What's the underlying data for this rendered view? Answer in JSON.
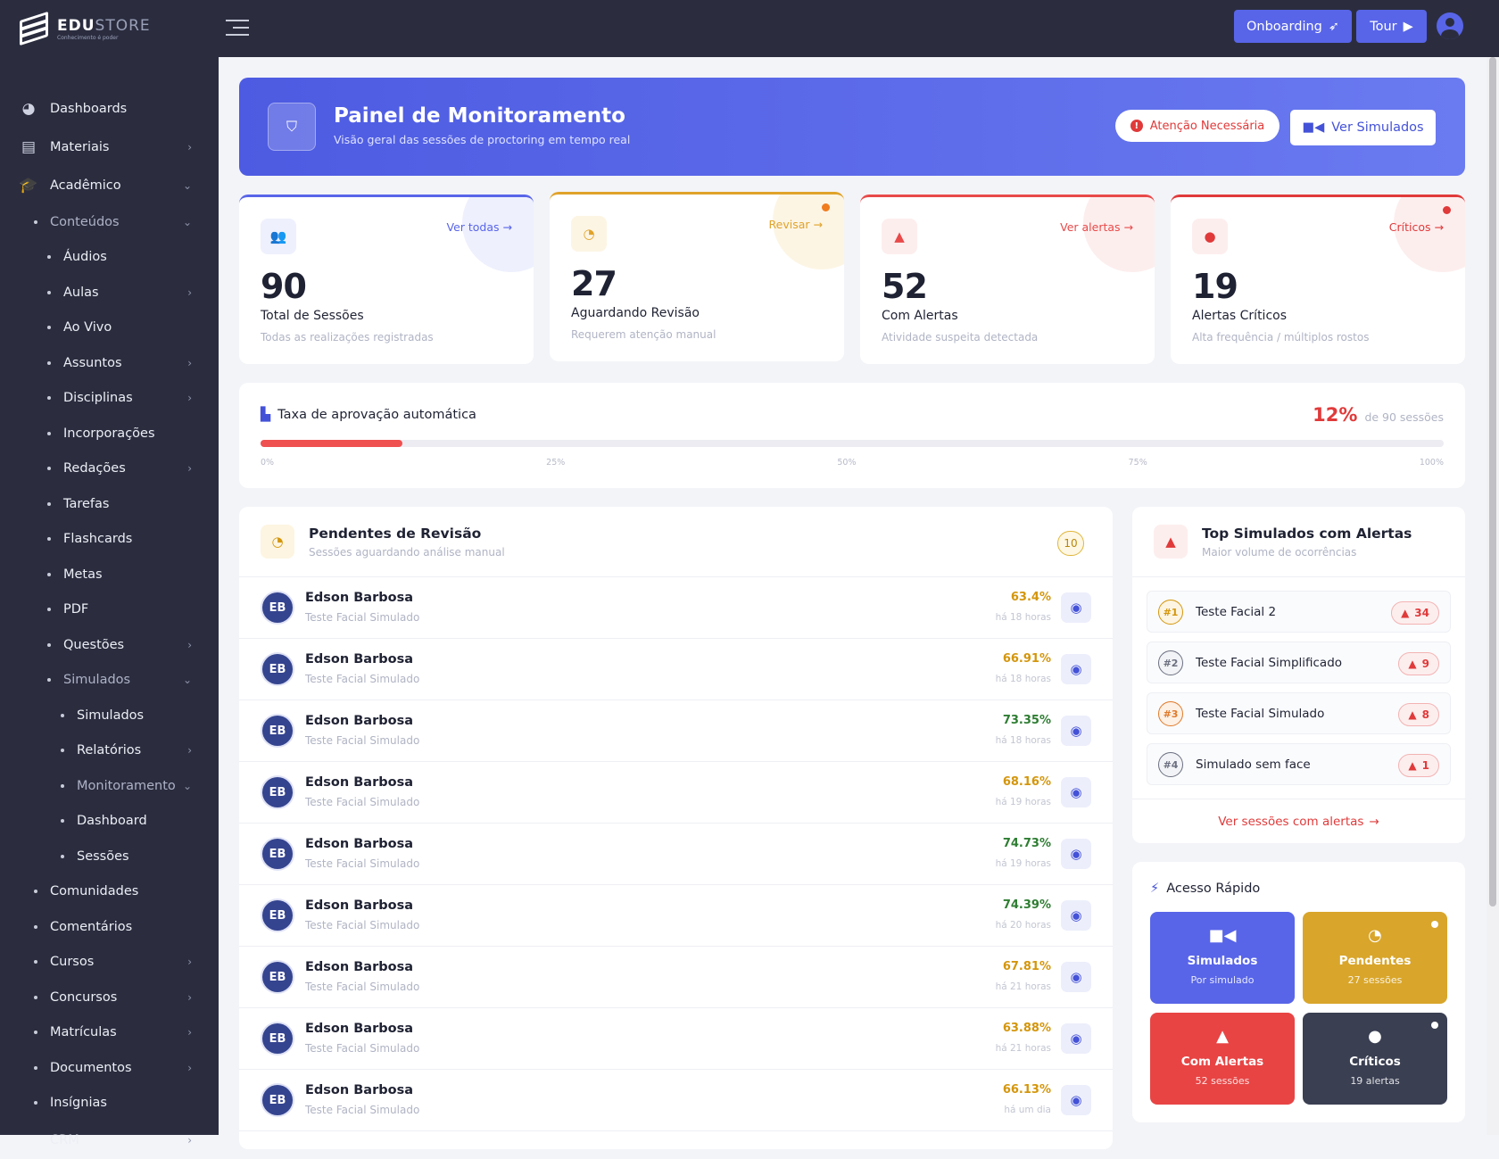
{
  "brand": {
    "name_a": "EDU",
    "name_b": "STORE",
    "tagline": "Conhecimento é poder"
  },
  "topbar": {
    "onboarding_label": "Onboarding",
    "tour_label": "Tour"
  },
  "sidebar": {
    "items": [
      {
        "label": "Dashboards",
        "level": 0,
        "icon": "dashboard-icon"
      },
      {
        "label": "Materiais",
        "level": 0,
        "icon": "pdf-icon",
        "chevron": "›"
      },
      {
        "label": "Acadêmico",
        "level": 0,
        "icon": "graduation-cap-icon",
        "chevron": "⌄"
      },
      {
        "label": "Conteúdos",
        "level": 1,
        "chevron": "⌄"
      },
      {
        "label": "Áudios",
        "level": 2
      },
      {
        "label": "Aulas",
        "level": 2,
        "chevron": "›"
      },
      {
        "label": "Ao Vivo",
        "level": 2
      },
      {
        "label": "Assuntos",
        "level": 2,
        "chevron": "›"
      },
      {
        "label": "Disciplinas",
        "level": 2,
        "chevron": "›"
      },
      {
        "label": "Incorporações",
        "level": 2
      },
      {
        "label": "Redações",
        "level": 2,
        "chevron": "›"
      },
      {
        "label": "Tarefas",
        "level": 2
      },
      {
        "label": "Flashcards",
        "level": 2
      },
      {
        "label": "Metas",
        "level": 2
      },
      {
        "label": "PDF",
        "level": 2
      },
      {
        "label": "Questões",
        "level": 2,
        "chevron": "›"
      },
      {
        "label": "Simulados",
        "level": 2,
        "chevron": "⌄"
      },
      {
        "label": "Simulados",
        "level": 3
      },
      {
        "label": "Relatórios",
        "level": 3,
        "chevron": "›"
      },
      {
        "label": "Monitoramento",
        "level": 3,
        "chevron": "⌄"
      },
      {
        "label": "Dashboard",
        "level": 3
      },
      {
        "label": "Sessões",
        "level": 3
      },
      {
        "label": "Comunidades",
        "level": 1
      },
      {
        "label": "Comentários",
        "level": 1
      },
      {
        "label": "Cursos",
        "level": 1,
        "chevron": "›"
      },
      {
        "label": "Concursos",
        "level": 1,
        "chevron": "›"
      },
      {
        "label": "Matrículas",
        "level": 1,
        "chevron": "›"
      },
      {
        "label": "Documentos",
        "level": 1,
        "chevron": "›"
      },
      {
        "label": "Insígnias",
        "level": 1
      },
      {
        "label": "CRM",
        "level": 0,
        "chevron": "›"
      }
    ]
  },
  "hero": {
    "title": "Painel de Monitoramento",
    "subtitle": "Visão geral das sessões de proctoring em tempo real",
    "alert_label": "Atenção Necessária",
    "sim_label": "Ver Simulados"
  },
  "stats": [
    {
      "value": "90",
      "label": "Total de Sessões",
      "sub": "Todas as realizações registradas",
      "link": "Ver todas",
      "color": "#5865e8",
      "soft": "#eef0fd",
      "icon": "users-icon",
      "glyph": "👥",
      "pulse": false
    },
    {
      "value": "27",
      "label": "Aguardando Revisão",
      "sub": "Requerem atenção manual",
      "link": "Revisar",
      "color": "#e0a32a",
      "soft": "#fdf5e4",
      "icon": "clock-icon",
      "glyph": "◔",
      "pulse": true,
      "pulse_color": "#f07c1e"
    },
    {
      "value": "52",
      "label": "Com Alertas",
      "sub": "Atividade suspeita detectada",
      "link": "Ver alertas",
      "color": "#e84a4a",
      "soft": "#fdeeee",
      "icon": "warning-icon",
      "glyph": "▲",
      "pulse": false
    },
    {
      "value": "19",
      "label": "Alertas Críticos",
      "sub": "Alta frequência / múltiplos rostos",
      "link": "Críticos",
      "color": "#e03a3a",
      "soft": "#fdeeee",
      "icon": "fire-icon",
      "glyph": "●",
      "pulse": true,
      "pulse_color": "#e03a3a"
    }
  ],
  "rate": {
    "title": "Taxa de aprovação automática",
    "value_label": "12%",
    "percent": 12,
    "sessions_label": "de 90 sessões",
    "ticks": [
      "0%",
      "25%",
      "50%",
      "75%",
      "100%"
    ]
  },
  "pending": {
    "title": "Pendentes de Revisão",
    "subtitle": "Sessões aguardando análise manual",
    "count": "10",
    "rows": [
      {
        "initials": "EB",
        "name": "Edson Barbosa",
        "test": "Teste Facial Simulado",
        "score": "63.4%",
        "score_color": "#d4960c",
        "time": "há 18 horas"
      },
      {
        "initials": "EB",
        "name": "Edson Barbosa",
        "test": "Teste Facial Simulado",
        "score": "66.91%",
        "score_color": "#d4960c",
        "time": "há 18 horas"
      },
      {
        "initials": "EB",
        "name": "Edson Barbosa",
        "test": "Teste Facial Simulado",
        "score": "73.35%",
        "score_color": "#2e7d32",
        "time": "há 18 horas"
      },
      {
        "initials": "EB",
        "name": "Edson Barbosa",
        "test": "Teste Facial Simulado",
        "score": "68.16%",
        "score_color": "#d4960c",
        "time": "há 19 horas"
      },
      {
        "initials": "EB",
        "name": "Edson Barbosa",
        "test": "Teste Facial Simulado",
        "score": "74.73%",
        "score_color": "#2e7d32",
        "time": "há 19 horas"
      },
      {
        "initials": "EB",
        "name": "Edson Barbosa",
        "test": "Teste Facial Simulado",
        "score": "74.39%",
        "score_color": "#2e7d32",
        "time": "há 20 horas"
      },
      {
        "initials": "EB",
        "name": "Edson Barbosa",
        "test": "Teste Facial Simulado",
        "score": "67.81%",
        "score_color": "#d4960c",
        "time": "há 21 horas"
      },
      {
        "initials": "EB",
        "name": "Edson Barbosa",
        "test": "Teste Facial Simulado",
        "score": "63.88%",
        "score_color": "#d4960c",
        "time": "há 21 horas"
      },
      {
        "initials": "EB",
        "name": "Edson Barbosa",
        "test": "Teste Facial Simulado",
        "score": "66.13%",
        "score_color": "#d4960c",
        "time": "há um dia"
      }
    ]
  },
  "top_alerts": {
    "title": "Top Simulados com Alertas",
    "subtitle": "Maior volume de ocorrências",
    "footer": "Ver sessões com alertas",
    "rows": [
      {
        "rank": "#1",
        "name": "Teste Facial 2",
        "count": "34",
        "rank_color": "#d4960c",
        "rank_bg": "#fdf5e1"
      },
      {
        "rank": "#2",
        "name": "Teste Facial Simplificado",
        "count": "9",
        "rank_color": "#6b6f80",
        "rank_bg": "#f2f3f6"
      },
      {
        "rank": "#3",
        "name": "Teste Facial Simulado",
        "count": "8",
        "rank_color": "#e07a2a",
        "rank_bg": "#fdf0e4"
      },
      {
        "rank": "#4",
        "name": "Simulado sem face",
        "count": "1",
        "rank_color": "#6b6f80",
        "rank_bg": "#f2f3f6"
      }
    ]
  },
  "quick": {
    "title": "Acesso Rápido",
    "tiles": [
      {
        "label": "Simulados",
        "sub": "Por simulado",
        "bg": "#5865e8",
        "icon": "video-icon",
        "glyph": "■◀",
        "dot": false
      },
      {
        "label": "Pendentes",
        "sub": "27 sessões",
        "bg": "#d9a62b",
        "icon": "clock-icon",
        "glyph": "◔",
        "dot": true
      },
      {
        "label": "Com Alertas",
        "sub": "52 sessões",
        "bg": "#e84444",
        "icon": "warning-icon",
        "glyph": "▲",
        "dot": false
      },
      {
        "label": "Críticos",
        "sub": "19 alertas",
        "bg": "#3a3f52",
        "icon": "fire-icon",
        "glyph": "●",
        "dot": true
      }
    ]
  }
}
